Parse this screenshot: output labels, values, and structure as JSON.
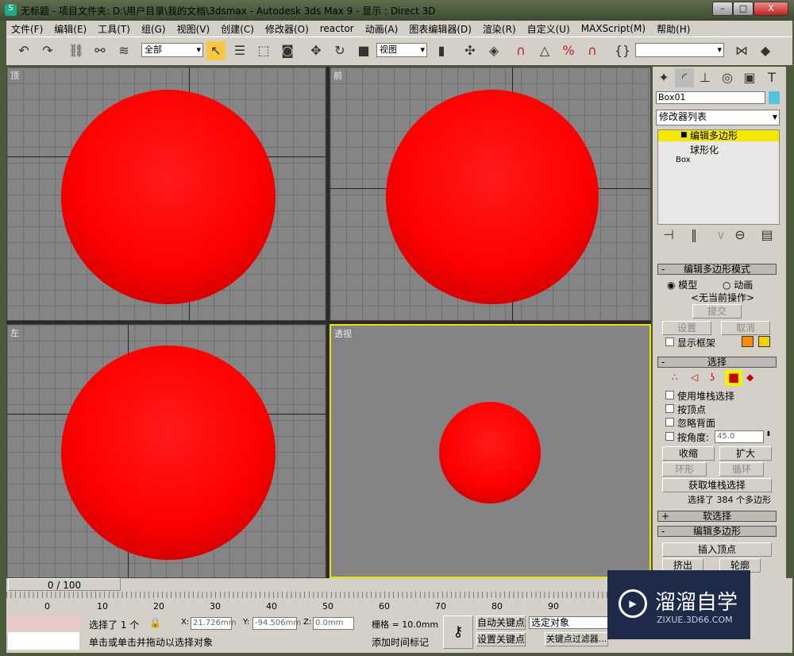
{
  "title": {
    "app_icon": "3dsmax-icon",
    "text": "无标题    - 项目文件夹: D:\\用户目录\\我的文档\\3dsmax    - Autodesk 3ds Max 9    - 显示 : Direct 3D",
    "minimize": "–",
    "maximize": "□",
    "close": "X"
  },
  "menu": [
    "文件(F)",
    "编辑(E)",
    "工具(T)",
    "组(G)",
    "视图(V)",
    "创建(C)",
    "修改器(O)",
    "reactor",
    "动画(A)",
    "图表编辑器(D)",
    "渲染(R)",
    "自定义(U)",
    "MAXScript(M)",
    "帮助(H)"
  ],
  "toolbar": {
    "selection_filter": "全部",
    "ref_coord": "视图",
    "named_selection": ""
  },
  "viewports": [
    {
      "label": "顶"
    },
    {
      "label": "前"
    },
    {
      "label": "左"
    },
    {
      "label": "透视"
    }
  ],
  "panel": {
    "object_name": "Box01",
    "object_color": "#4fc3e0",
    "modifier_list": "修改器列表",
    "stack": [
      "编辑多边形",
      "球形化",
      "Box"
    ],
    "edit_poly_mode": {
      "title": "编辑多边形模式",
      "model": "模型",
      "animate": "动画",
      "no_op": "<无当前操作>",
      "commit": "提交",
      "settings": "设置",
      "cancel": "取消",
      "show_cage": "显示框架",
      "cage_colors": [
        "#ff8c00",
        "#f5d000"
      ]
    },
    "selection": {
      "title": "选择",
      "use_stack": "使用堆栈选择",
      "by_vertex": "按顶点",
      "ignore_backface": "忽略背面",
      "by_angle": "按角度:",
      "angle_value": "45.0",
      "shrink": "收缩",
      "grow": "扩大",
      "ring": "环形",
      "loop": "循环",
      "get_stack": "获取堆栈选择",
      "status": "选择了 384 个多边形"
    },
    "soft_selection": "软选择",
    "edit_poly": {
      "title": "编辑多边形",
      "insert_vertex": "插入顶点",
      "extrude": "挤出",
      "outline": "轮廓"
    }
  },
  "timeline": {
    "frame": "0 / 100",
    "ticks": [
      "0",
      "10",
      "20",
      "30",
      "40",
      "50",
      "60",
      "70",
      "80",
      "90"
    ]
  },
  "status": {
    "selected": "选择了 1 个",
    "x": "21.726mm",
    "y": "-94.506mm",
    "z": "0.0mm",
    "grid": "栅格 = 10.0mm",
    "prompt": "单击或单击并拖动以选择对象",
    "add_time_tag": "添加时间标记",
    "auto_key": "自动关键点",
    "set_key": "设置关键点",
    "key_mode": "选定对象",
    "key_filters": "关键点过滤器..."
  },
  "watermark": {
    "name": "溜溜自学",
    "url": "ZIXUE.3D66.COM"
  }
}
